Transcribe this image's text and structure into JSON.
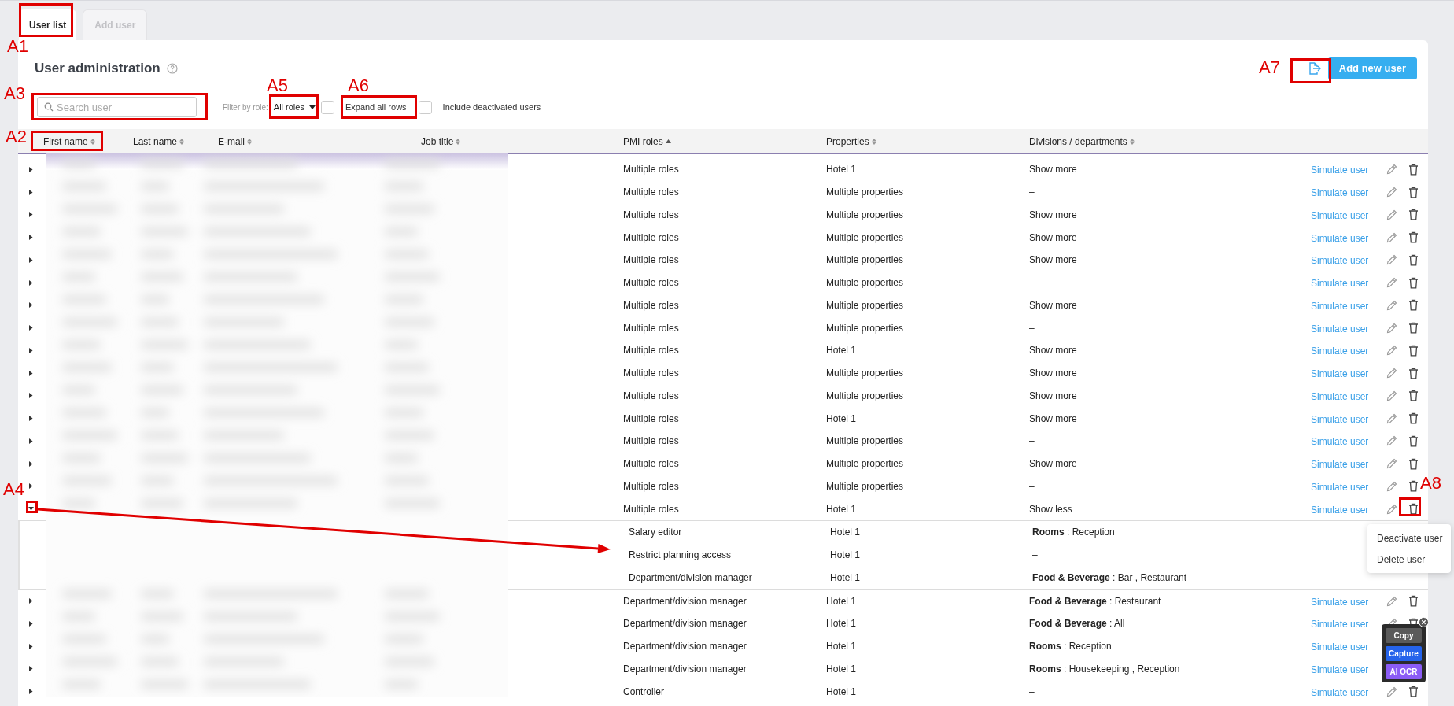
{
  "tabs": [
    {
      "label": "User list",
      "selected": true
    },
    {
      "label": "Add user",
      "selected": false
    }
  ],
  "title": "User administration",
  "search": {
    "placeholder": "Search user"
  },
  "filter": {
    "label": "Filter by role:",
    "value": "All roles"
  },
  "checkboxes": [
    {
      "label": "Expand all rows",
      "checked": false
    },
    {
      "label": "Include deactivated users",
      "checked": false
    }
  ],
  "add_button": "Add new user",
  "columns": [
    {
      "label": "First name",
      "sorted": false
    },
    {
      "label": "Last name",
      "sorted": false
    },
    {
      "label": "E-mail",
      "sorted": false
    },
    {
      "label": "Job title",
      "sorted": false
    },
    {
      "label": "PMI roles",
      "sorted": true
    },
    {
      "label": "Properties",
      "sorted": false
    },
    {
      "label": "Divisions / departments",
      "sorted": false
    }
  ],
  "rows": [
    {
      "roles": "Multiple roles",
      "properties": "Hotel 1",
      "divisions": "Show more",
      "action": "Simulate user",
      "expanded": false
    },
    {
      "roles": "Multiple roles",
      "properties": "Multiple properties",
      "divisions": "–",
      "action": "Simulate user",
      "expanded": false
    },
    {
      "roles": "Multiple roles",
      "properties": "Multiple properties",
      "divisions": "Show more",
      "action": "Simulate user",
      "expanded": false
    },
    {
      "roles": "Multiple roles",
      "properties": "Multiple properties",
      "divisions": "Show more",
      "action": "Simulate user",
      "expanded": false
    },
    {
      "roles": "Multiple roles",
      "properties": "Multiple properties",
      "divisions": "Show more",
      "action": "Simulate user",
      "expanded": false
    },
    {
      "roles": "Multiple roles",
      "properties": "Multiple properties",
      "divisions": "–",
      "action": "Simulate user",
      "expanded": false
    },
    {
      "roles": "Multiple roles",
      "properties": "Multiple properties",
      "divisions": "Show more",
      "action": "Simulate user",
      "expanded": false
    },
    {
      "roles": "Multiple roles",
      "properties": "Multiple properties",
      "divisions": "–",
      "action": "Simulate user",
      "expanded": false
    },
    {
      "roles": "Multiple roles",
      "properties": "Hotel 1",
      "divisions": "Show more",
      "action": "Simulate user",
      "expanded": false
    },
    {
      "roles": "Multiple roles",
      "properties": "Multiple properties",
      "divisions": "Show more",
      "action": "Simulate user",
      "expanded": false
    },
    {
      "roles": "Multiple roles",
      "properties": "Multiple properties",
      "divisions": "Show more",
      "action": "Simulate user",
      "expanded": false
    },
    {
      "roles": "Multiple roles",
      "properties": "Hotel 1",
      "divisions": "Show more",
      "action": "Simulate user",
      "expanded": false
    },
    {
      "roles": "Multiple roles",
      "properties": "Multiple properties",
      "divisions": "–",
      "action": "Simulate user",
      "expanded": false
    },
    {
      "roles": "Multiple roles",
      "properties": "Multiple properties",
      "divisions": "Show more",
      "action": "Simulate user",
      "expanded": false
    },
    {
      "roles": "Multiple roles",
      "properties": "Multiple properties",
      "divisions": "–",
      "action": "Simulate user",
      "expanded": false
    },
    {
      "roles": "Multiple roles",
      "properties": "Hotel 1",
      "divisions": "Show less",
      "action": "Simulate user",
      "expanded": true,
      "children": [
        {
          "roles": "Salary editor",
          "properties": "Hotel 1",
          "divisions": "**Rooms** : Reception"
        },
        {
          "roles": "Restrict planning access",
          "properties": "Hotel 1",
          "divisions": "–"
        },
        {
          "roles": "Department/division manager",
          "properties": "Hotel 1",
          "divisions": "**Food & Beverage** : Bar , Restaurant"
        }
      ]
    },
    {
      "roles": "Department/division manager",
      "properties": "Hotel 1",
      "divisions": "**Food & Beverage** : Restaurant",
      "action": "Simulate user",
      "expanded": false
    },
    {
      "roles": "Department/division manager",
      "properties": "Hotel 1",
      "divisions": "**Food & Beverage** : All",
      "action": "Simulate user",
      "expanded": false
    },
    {
      "roles": "Department/division manager",
      "properties": "Hotel 1",
      "divisions": "**Rooms** : Reception",
      "action": "Simulate user",
      "expanded": false
    },
    {
      "roles": "Department/division manager",
      "properties": "Hotel 1",
      "divisions": "**Rooms** : Housekeeping , Reception",
      "action": "Simulate user",
      "expanded": false
    },
    {
      "roles": "Controller",
      "properties": "Hotel 1",
      "divisions": "–",
      "action": "Simulate user",
      "expanded": false
    }
  ],
  "row_menu": [
    "Deactivate user",
    "Delete user"
  ],
  "capture_widget": [
    "Copy",
    "Capture",
    "AI OCR"
  ],
  "annotations": [
    {
      "label": "A1"
    },
    {
      "label": "A7"
    },
    {
      "label": "A5"
    },
    {
      "label": "A6"
    },
    {
      "label": "A3"
    },
    {
      "label": "A2"
    },
    {
      "label": "A8"
    },
    {
      "label": "A4"
    }
  ]
}
